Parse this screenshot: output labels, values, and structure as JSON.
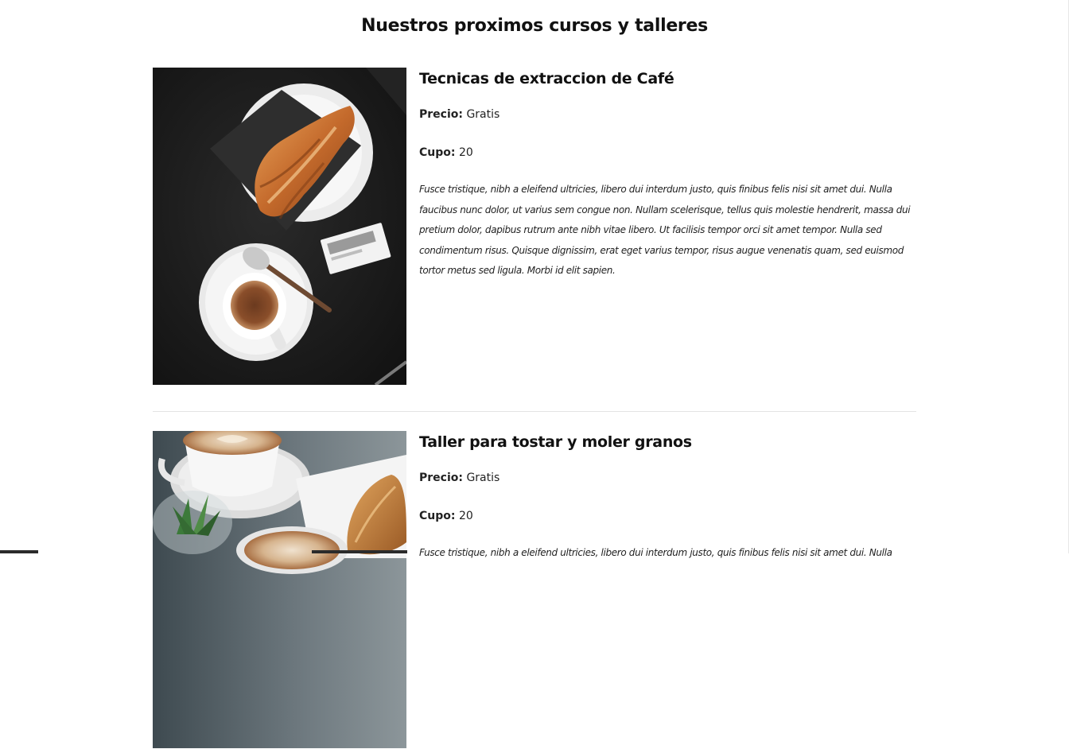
{
  "page": {
    "title": "Nuestros proximos cursos y talleres"
  },
  "courses": [
    {
      "title": "Tecnicas de extraccion de Café",
      "price_label": "Precio:",
      "price_value": "Gratis",
      "cupo_label": "Cupo:",
      "cupo_value": "20",
      "description": "Fusce tristique, nibh a eleifend ultricies, libero dui interdum justo, quis finibus felis nisi sit amet dui. Nulla faucibus nunc dolor, ut varius sem congue non. Nullam scelerisque, tellus quis molestie hendrerit, massa dui pretium dolor, dapibus rutrum ante nibh vitae libero. Ut facilisis tempor orci sit amet tempor. Nulla sed condimentum risus. Quisque dignissim, erat eget varius tempor, risus augue venenatis quam, sed euismod tortor metus sed ligula. Morbi id elit sapien.",
      "image_icon": "croissant-coffee-photo"
    },
    {
      "title": "Taller para tostar y moler granos",
      "price_label": "Precio:",
      "price_value": "Gratis",
      "cupo_label": "Cupo:",
      "cupo_value": "20",
      "description": "Fusce tristique, nibh a eleifend ultricies, libero dui interdum justo, quis finibus felis nisi sit amet dui. Nulla",
      "image_icon": "latte-pastry-photo"
    }
  ],
  "colors": {
    "text": "#111111",
    "divider": "#e3e3e3",
    "photo1_background": "#161616",
    "photo2_background": "#6f7a80"
  }
}
